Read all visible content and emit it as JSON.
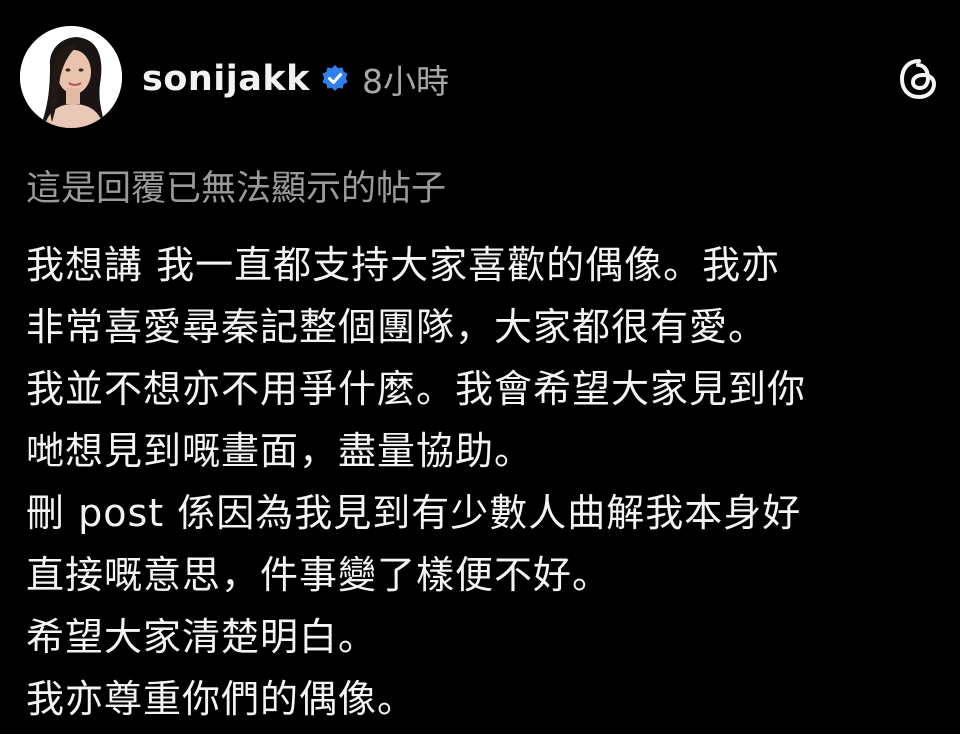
{
  "post": {
    "username": "sonijakk",
    "time": "8小時",
    "reply_note": "這是回覆已無法顯示的帖子",
    "lines": [
      "我想講 我一直都支持大家喜歡的偶像。我亦",
      "非常喜愛尋秦記整個團隊，大家都很有愛。",
      "我並不想亦不用爭什麼。我會希望大家見到你",
      "哋想見到嘅畫面，盡量協助。",
      "刪 post 係因為我見到有少數人曲解我本身好",
      "直接嘅意思，件事變了樣便不好。",
      "希望大家清楚明白。",
      "我亦尊重你們的偶像。"
    ]
  },
  "icons": {
    "avatar": "profile-photo",
    "verified": "verified-badge-icon",
    "threads": "threads-logo-icon"
  },
  "colors": {
    "background": "#000000",
    "text": "#f4f4f4",
    "muted": "#9a9a9a",
    "verified": "#2f80ed"
  }
}
